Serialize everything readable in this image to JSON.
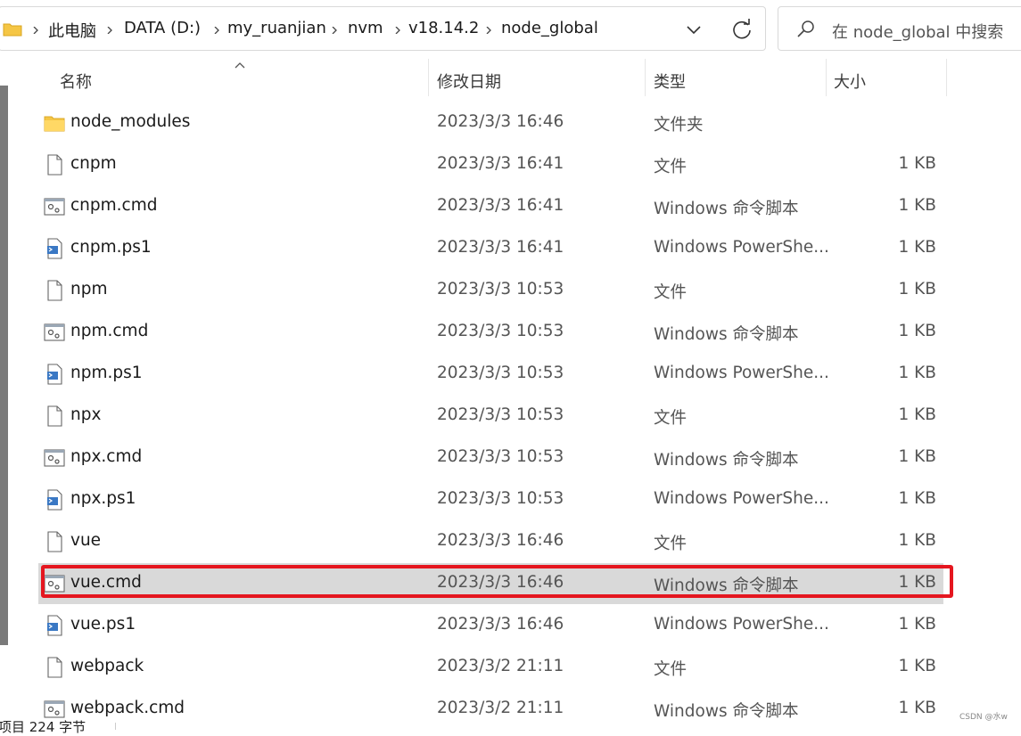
{
  "address": {
    "crumbs": [
      "此电脑",
      "DATA (D:)",
      "my_ruanjian",
      "nvm",
      "v18.14.2",
      "node_global"
    ]
  },
  "search": {
    "placeholder": "在 node_global 中搜索"
  },
  "columns": {
    "name": "名称",
    "date": "修改日期",
    "type": "类型",
    "size": "大小"
  },
  "files": [
    {
      "name": "node_modules",
      "date": "2023/3/3 16:46",
      "type": "文件夹",
      "size": "",
      "icon": "folder-icon"
    },
    {
      "name": "cnpm",
      "date": "2023/3/3 16:41",
      "type": "文件",
      "size": "1 KB",
      "icon": "file-icon"
    },
    {
      "name": "cnpm.cmd",
      "date": "2023/3/3 16:41",
      "type": "Windows 命令脚本",
      "size": "1 KB",
      "icon": "cmd-icon"
    },
    {
      "name": "cnpm.ps1",
      "date": "2023/3/3 16:41",
      "type": "Windows PowerShe...",
      "size": "1 KB",
      "icon": "ps1-icon"
    },
    {
      "name": "npm",
      "date": "2023/3/3 10:53",
      "type": "文件",
      "size": "1 KB",
      "icon": "file-icon"
    },
    {
      "name": "npm.cmd",
      "date": "2023/3/3 10:53",
      "type": "Windows 命令脚本",
      "size": "1 KB",
      "icon": "cmd-icon"
    },
    {
      "name": "npm.ps1",
      "date": "2023/3/3 10:53",
      "type": "Windows PowerShe...",
      "size": "1 KB",
      "icon": "ps1-icon"
    },
    {
      "name": "npx",
      "date": "2023/3/3 10:53",
      "type": "文件",
      "size": "1 KB",
      "icon": "file-icon"
    },
    {
      "name": "npx.cmd",
      "date": "2023/3/3 10:53",
      "type": "Windows 命令脚本",
      "size": "1 KB",
      "icon": "cmd-icon"
    },
    {
      "name": "npx.ps1",
      "date": "2023/3/3 10:53",
      "type": "Windows PowerShe...",
      "size": "1 KB",
      "icon": "ps1-icon"
    },
    {
      "name": "vue",
      "date": "2023/3/3 16:46",
      "type": "文件",
      "size": "1 KB",
      "icon": "file-icon"
    },
    {
      "name": "vue.cmd",
      "date": "2023/3/3 16:46",
      "type": "Windows 命令脚本",
      "size": "1 KB",
      "icon": "cmd-icon",
      "selected": true
    },
    {
      "name": "vue.ps1",
      "date": "2023/3/3 16:46",
      "type": "Windows PowerShe...",
      "size": "1 KB",
      "icon": "ps1-icon"
    },
    {
      "name": "webpack",
      "date": "2023/3/2 21:11",
      "type": "文件",
      "size": "1 KB",
      "icon": "file-icon"
    },
    {
      "name": "webpack.cmd",
      "date": "2023/3/2 21:11",
      "type": "Windows 命令脚本",
      "size": "1 KB",
      "icon": "cmd-icon"
    }
  ],
  "status": {
    "text": "项目 224 字节"
  },
  "watermark": "CSDN @水w",
  "colors": {
    "highlight": "#e5161f",
    "selected_row": "#d9d9d9",
    "folder": "#f5c645"
  }
}
